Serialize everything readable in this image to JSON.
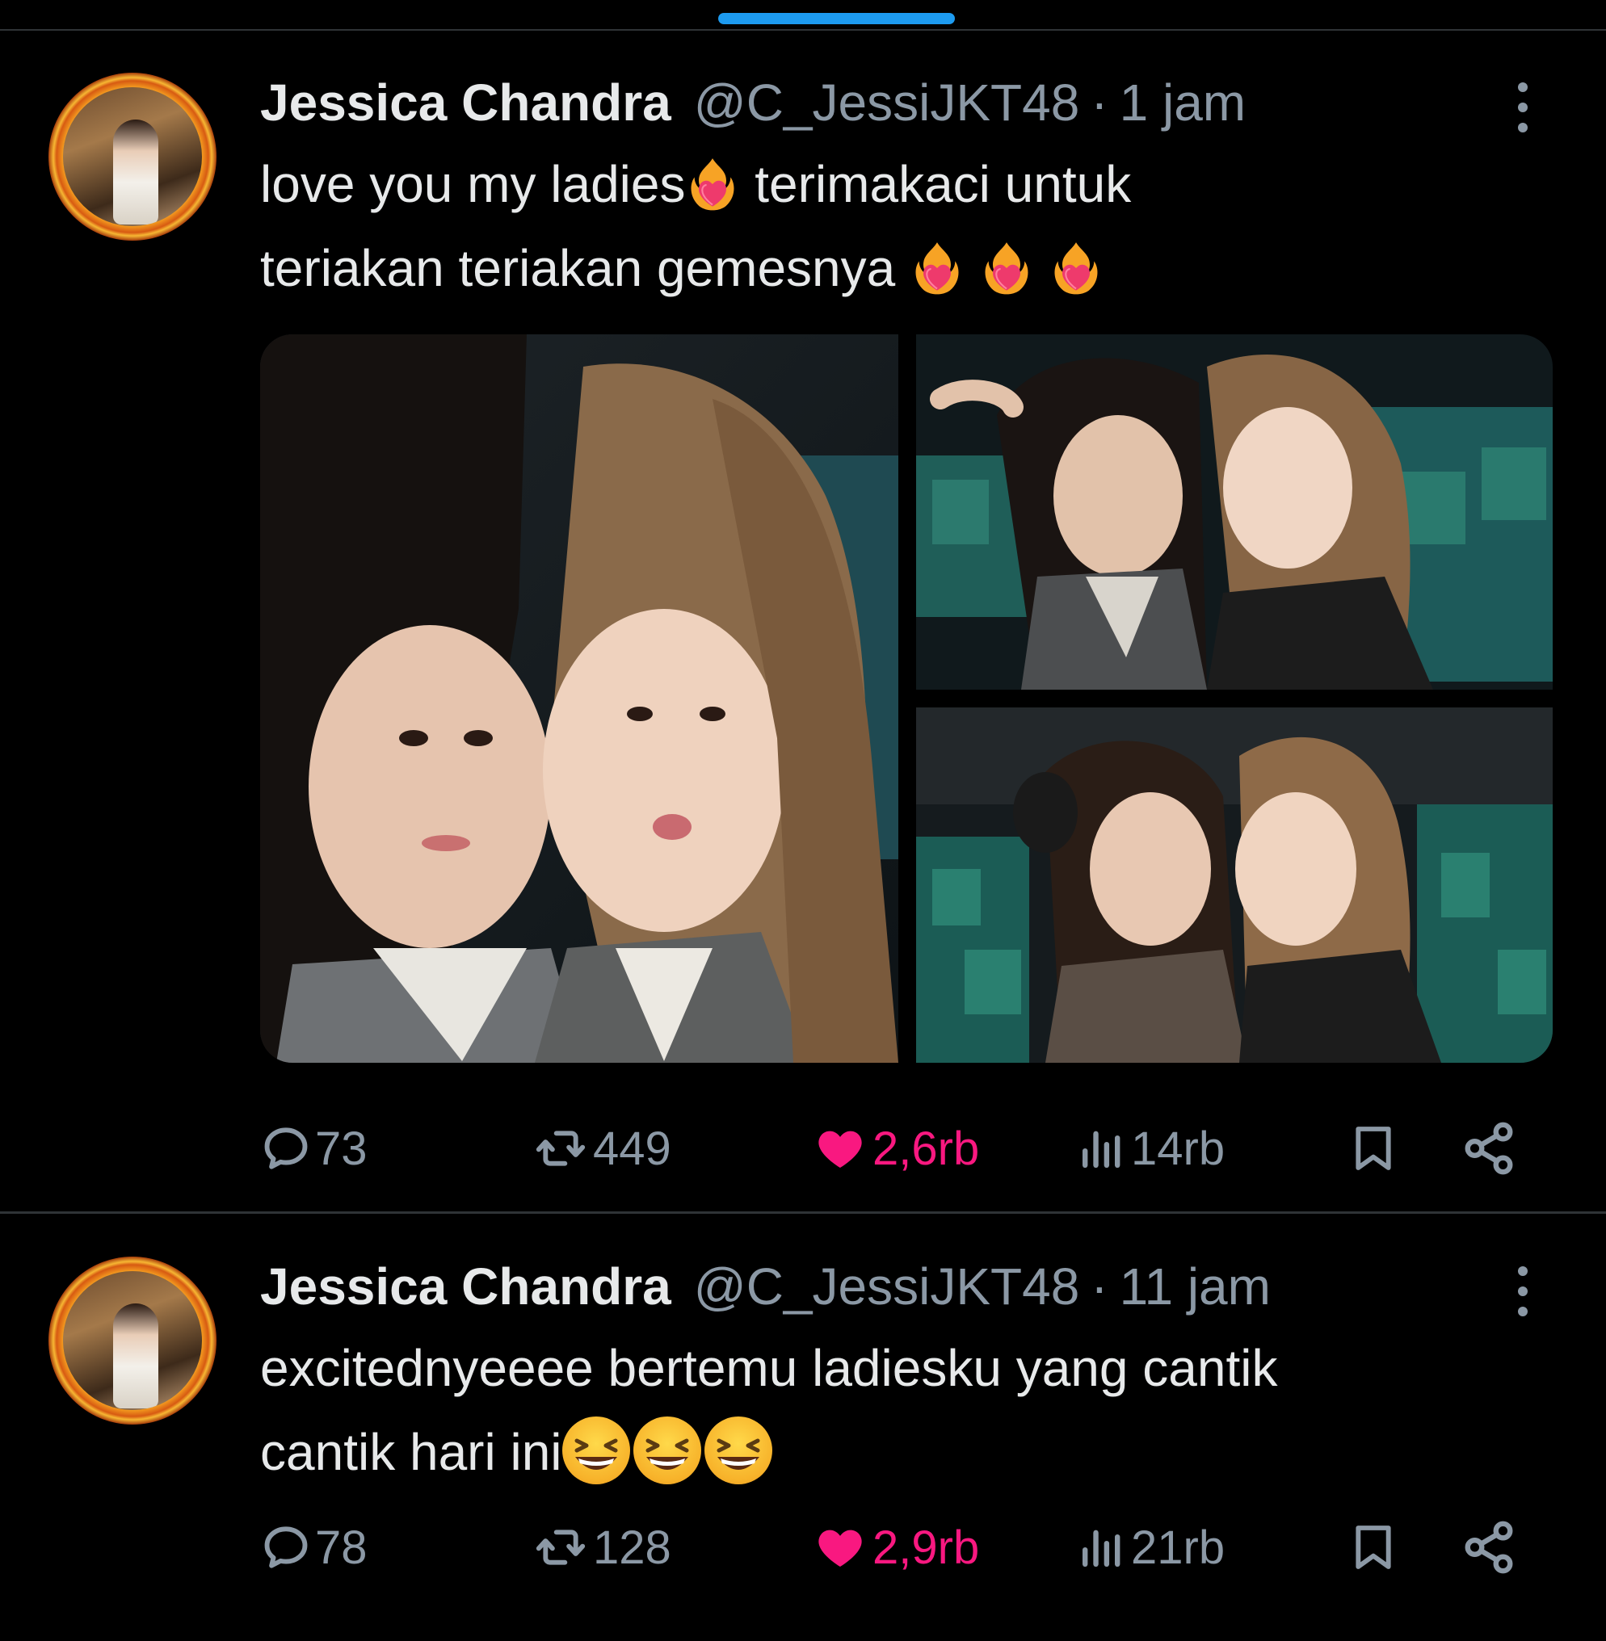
{
  "theme": {
    "background": "#000000",
    "text": "#e7e9ea",
    "muted": "#8b98a5",
    "accent": "#1d9bf0",
    "like": "#f91880",
    "divider": "#2f3336"
  },
  "tweets": [
    {
      "author_name": "Jessica Chandra",
      "handle": "@C_JessiJKT48",
      "separator": "·",
      "time": "1 jam",
      "text_line1": "love you my ladies",
      "text_line1b": " terimakaci untuk",
      "text_line2": "teriakan teriakan gemesnya ",
      "emoji": "heart-on-fire",
      "media_count": 3,
      "stats": {
        "replies": "73",
        "retweets": "449",
        "likes": "2,6rb",
        "views": "14rb"
      },
      "liked": true
    },
    {
      "author_name": "Jessica Chandra",
      "handle": "@C_JessiJKT48",
      "separator": "·",
      "time": "11 jam",
      "text_line1": "excitednyeeee bertemu ladiesku yang cantik",
      "text_line2": "cantik hari ini",
      "emoji": "grinning-squinting-face",
      "stats": {
        "replies": "78",
        "retweets": "128",
        "likes": "2,9rb",
        "views": "21rb"
      },
      "liked": true
    }
  ],
  "icons": {
    "reply": "reply-icon",
    "retweet": "retweet-icon",
    "like": "heart-icon",
    "views": "views-icon",
    "bookmark": "bookmark-icon",
    "share": "share-icon",
    "more": "more-icon"
  }
}
